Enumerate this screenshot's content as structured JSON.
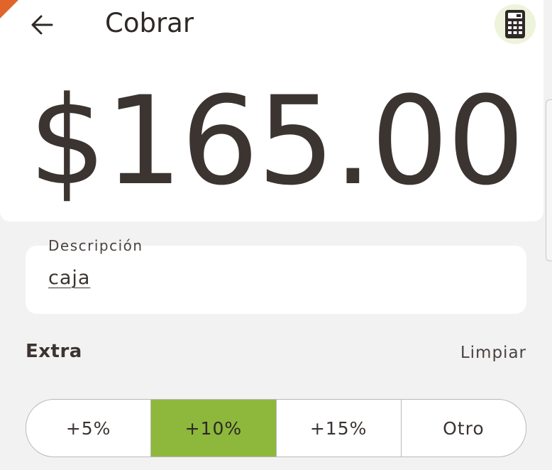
{
  "header": {
    "title": "Cobrar",
    "back_icon": "arrow-left-icon",
    "calculator_icon": "calculator-icon"
  },
  "amount": {
    "display": "$165.00"
  },
  "description": {
    "label": "Descripción",
    "value": "caja"
  },
  "extra": {
    "label": "Extra",
    "clear_label": "Limpiar",
    "options": [
      "+5%",
      "+10%",
      "+15%",
      "Otro"
    ],
    "selected_index": 1
  },
  "colors": {
    "accent": "#8db83c",
    "ribbon": "#e0652a",
    "calc_bg": "#eef3dc",
    "text": "#3b3431"
  }
}
